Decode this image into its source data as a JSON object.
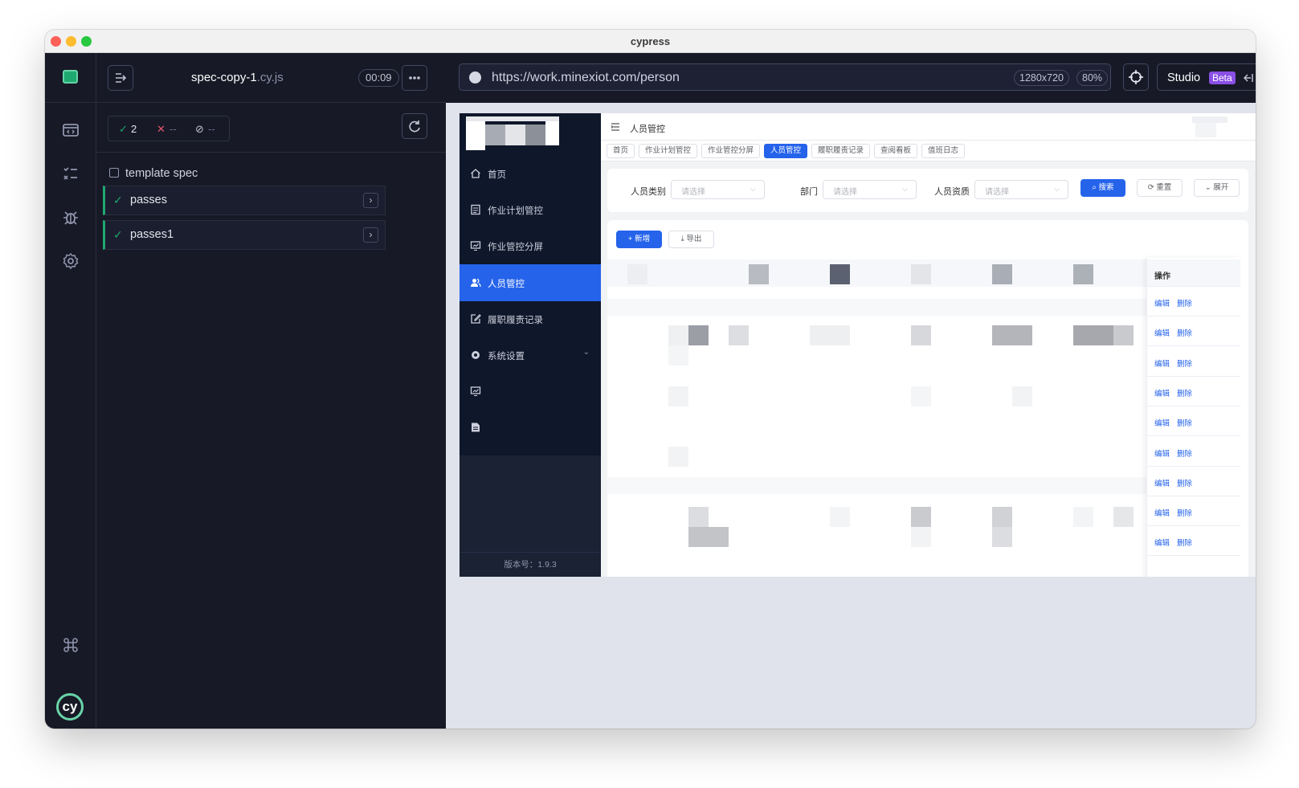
{
  "window": {
    "title": "cypress"
  },
  "runner": {
    "spec_name": "spec-copy-1",
    "spec_ext": ".cy.js",
    "timer": "00:09",
    "stats": {
      "passed": "2",
      "failed": "--",
      "pending": "--"
    },
    "tree_root": "template spec",
    "tests": [
      {
        "name": "passes",
        "status": "passed"
      },
      {
        "name": "passes1",
        "status": "passed"
      }
    ]
  },
  "aut": {
    "url": "https://work.minexiot.com/person",
    "viewport": "1280x720",
    "zoom": "80%",
    "studio_label": "Studio",
    "studio_badge": "Beta"
  },
  "app": {
    "header_title": "人员管控",
    "nav": [
      {
        "label": "首页",
        "icon": "home-icon"
      },
      {
        "label": "作业计划管控",
        "icon": "document-icon"
      },
      {
        "label": "作业管控分屏",
        "icon": "monitor-chart-icon"
      },
      {
        "label": "人员管控",
        "icon": "users-icon",
        "active": true
      },
      {
        "label": "履职履责记录",
        "icon": "edit-icon"
      },
      {
        "label": "系统设置",
        "icon": "settings-icon",
        "has_submenu": true
      }
    ],
    "version": "版本号：1.9.3",
    "tags": [
      "首页",
      "作业计划管控",
      "作业管控分屏",
      "人员管控",
      "履职履责记录",
      "查阅看板",
      "值班日志"
    ],
    "active_tag_index": 3,
    "filters": {
      "person_type": {
        "label": "人员类别",
        "placeholder": "请选择"
      },
      "dept": {
        "label": "部门",
        "placeholder": "请选择"
      },
      "qualification": {
        "label": "人员资质",
        "placeholder": "请选择"
      }
    },
    "buttons": {
      "search": "搜索",
      "reset": "重置",
      "expand": "展开",
      "add": "新增",
      "export": "导出"
    },
    "table": {
      "op_header": "操作",
      "row_actions": {
        "edit": "编辑",
        "delete": "删除"
      },
      "row_count": 9
    }
  },
  "colors": {
    "accent": "#2563eb",
    "pass": "#1fa971",
    "fail": "#e45770",
    "brand_badge": "#8a4fe6"
  }
}
